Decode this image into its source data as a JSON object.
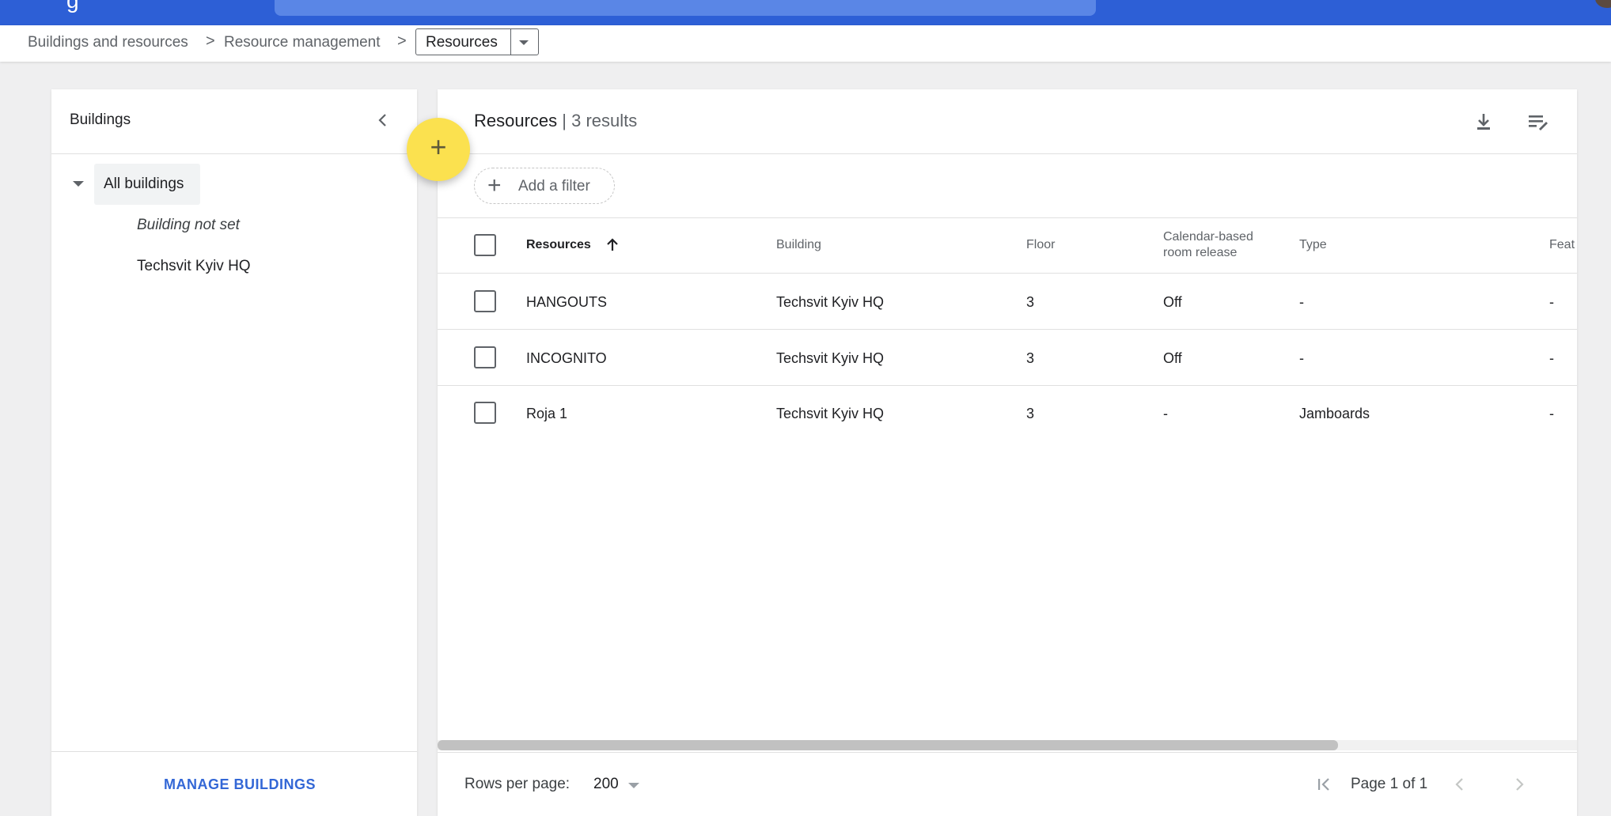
{
  "topbar": {
    "brand_fragment": "g"
  },
  "breadcrumb": {
    "items": [
      "Buildings and resources",
      "Resource management"
    ],
    "separator": ">",
    "current": "Resources"
  },
  "buildings_panel": {
    "title": "Buildings",
    "tree": {
      "root": "All buildings",
      "children": [
        "Building not set",
        "Techsvit Kyiv HQ"
      ]
    },
    "manage_label": "MANAGE BUILDINGS"
  },
  "fab": {
    "icon": "plus-icon",
    "label": "+"
  },
  "resources": {
    "title": "Resources",
    "count_text": "| 3 results",
    "filter_label": "Add a filter",
    "columns": [
      "Resources",
      "Building",
      "Floor",
      "Calendar-based room release",
      "Type",
      "Feat"
    ],
    "calendar_header_lines": [
      "Calendar-based",
      "room release"
    ],
    "rows": [
      [
        "HANGOUTS",
        "Techsvit Kyiv HQ",
        "3",
        "Off",
        "-",
        "-"
      ],
      [
        "INCOGNITO",
        "Techsvit Kyiv HQ",
        "3",
        "Off",
        "-",
        "-"
      ],
      [
        "Roja 1",
        "Techsvit Kyiv HQ",
        "3",
        "-",
        "Jamboards",
        "-"
      ]
    ],
    "footer": {
      "rows_per_page_label": "Rows per page:",
      "rows_per_page_value": "200",
      "page_label": "Page 1 of 1"
    }
  },
  "colors": {
    "topbar": "#2d5fd6",
    "accent_link": "#3367d6",
    "fab": "#fbe14f"
  }
}
